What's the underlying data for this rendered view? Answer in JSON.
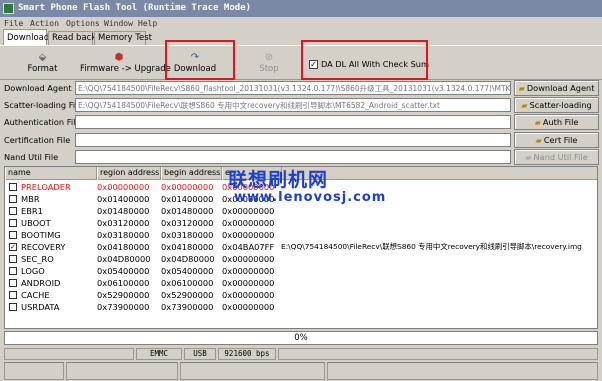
{
  "window": {
    "title": "Smart Phone Flash Tool (Runtime Trace Mode)"
  },
  "menu": [
    "File",
    "Action",
    "Options",
    "Window",
    "Help"
  ],
  "tabs": [
    "Download",
    "Read back",
    "Memory Test"
  ],
  "toolbar": {
    "format": "Format",
    "firmware_upgrade": "Firmware -> Upgrade",
    "download": "Download",
    "stop": "Stop",
    "checksum_label": "DA DL All With Check Sum",
    "checksum_checked": true
  },
  "fields": [
    {
      "label": "Download Agent",
      "value": "E:\\QQ\\754184500\\FileRecv\\S860_flashtool_20131031(v3.1324.0.177)\\S860升级工具_20131031(v3.1324.0.177)\\MTK_AllIn",
      "button": "Download Agent",
      "button_icon": "folder-open-icon",
      "button_enabled": true
    },
    {
      "label": "Scatter-loading File",
      "value": "E:\\QQ\\754184500\\FileRecv\\联想S860 专用中文recovery和线刷引导脚本\\MT6582_Android_scatter.txt",
      "button": "Scatter-loading",
      "button_icon": "folder-open-icon",
      "button_enabled": true
    },
    {
      "label": "Authentication File",
      "value": "",
      "button": "Auth File",
      "button_icon": "folder-open-icon",
      "button_enabled": true
    },
    {
      "label": "Certification File",
      "value": "",
      "button": "Cert File",
      "button_icon": "folder-open-icon",
      "button_enabled": true
    },
    {
      "label": "Nand Util File",
      "value": "",
      "button": "Nand Util File",
      "button_icon": "folder-open-icon",
      "button_enabled": false
    }
  ],
  "table": {
    "columns": [
      "name",
      "region address",
      "begin address",
      "en"
    ],
    "rows": [
      {
        "name": "PRELOADER",
        "region": "0x00000000",
        "begin": "0x00000000",
        "end": "0x00000000",
        "location": "",
        "checked": false,
        "highlight": true
      },
      {
        "name": "MBR",
        "region": "0x01400000",
        "begin": "0x01400000",
        "end": "0x00000000",
        "location": "",
        "checked": false,
        "highlight": false
      },
      {
        "name": "EBR1",
        "region": "0x01480000",
        "begin": "0x01480000",
        "end": "0x00000000",
        "location": "",
        "checked": false,
        "highlight": false
      },
      {
        "name": "UBOOT",
        "region": "0x03120000",
        "begin": "0x03120000",
        "end": "0x00000000",
        "location": "",
        "checked": false,
        "highlight": false
      },
      {
        "name": "BOOTIMG",
        "region": "0x03180000",
        "begin": "0x03180000",
        "end": "0x00000000",
        "location": "",
        "checked": false,
        "highlight": false
      },
      {
        "name": "RECOVERY",
        "region": "0x04180000",
        "begin": "0x04180000",
        "end": "0x04BA07FF",
        "location": "E:\\QQ\\754184500\\FileRecv\\联想S860 专用中文recovery和线刷引导脚本\\recovery.img",
        "checked": true,
        "highlight": false
      },
      {
        "name": "SEC_RO",
        "region": "0x04D80000",
        "begin": "0x04D80000",
        "end": "0x00000000",
        "location": "",
        "checked": false,
        "highlight": false
      },
      {
        "name": "LOGO",
        "region": "0x05400000",
        "begin": "0x05400000",
        "end": "0x00000000",
        "location": "",
        "checked": false,
        "highlight": false
      },
      {
        "name": "ANDROID",
        "region": "0x06100000",
        "begin": "0x06100000",
        "end": "0x00000000",
        "location": "",
        "checked": false,
        "highlight": false
      },
      {
        "name": "CACHE",
        "region": "0x52900000",
        "begin": "0x52900000",
        "end": "0x00000000",
        "location": "",
        "checked": false,
        "highlight": false
      },
      {
        "name": "USRDATA",
        "region": "0x73900000",
        "begin": "0x73900000",
        "end": "0x00000000",
        "location": "",
        "checked": false,
        "highlight": false
      }
    ]
  },
  "watermark": {
    "title": "联想刷机网",
    "url": "www.lenovosj.com"
  },
  "progress": {
    "text": "0%",
    "value": 0
  },
  "status": {
    "storage": "EMMC",
    "interface": "USB",
    "baud": "921600 bps"
  },
  "colors": {
    "titlebar": "#7a8aa6",
    "highlight_red": "#e31212",
    "annotation_box": "#e0141c",
    "watermark_blue": "#1d3fd0",
    "window_bg": "#d4d0c8"
  }
}
